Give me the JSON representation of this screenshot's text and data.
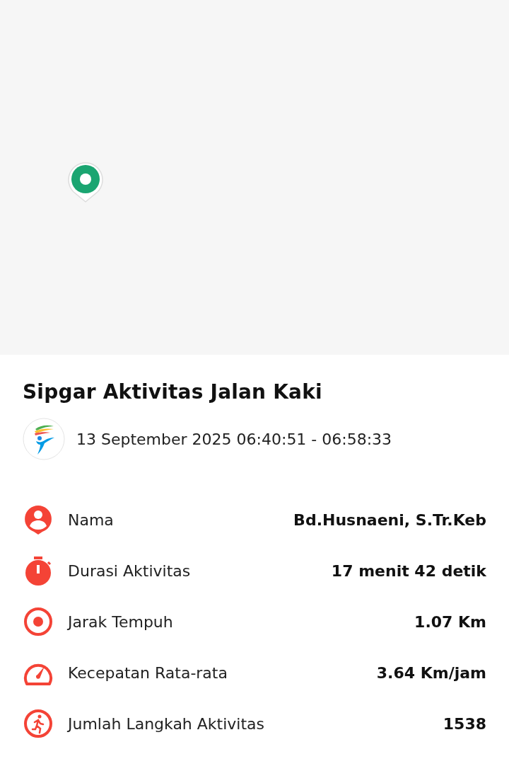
{
  "map": {
    "pin": {
      "color": "#1aa571"
    }
  },
  "title": "Sipgar Aktivitas Jalan Kaki",
  "date_range": "13 September 2025 06:40:51 - 06:58:33",
  "stats": [
    {
      "kind": "person",
      "label": "Nama",
      "value": "Bd.Husnaeni, S.Tr.Keb"
    },
    {
      "kind": "timer",
      "label": "Durasi Aktivitas",
      "value": "17 menit 42 detik"
    },
    {
      "kind": "distance",
      "label": "Jarak Tempuh",
      "value": "1.07 Km"
    },
    {
      "kind": "speed",
      "label": "Kecepatan Rata-rata",
      "value": "3.64 Km/jam"
    },
    {
      "kind": "steps",
      "label": "Jumlah Langkah Aktivitas",
      "value": "1538"
    }
  ]
}
